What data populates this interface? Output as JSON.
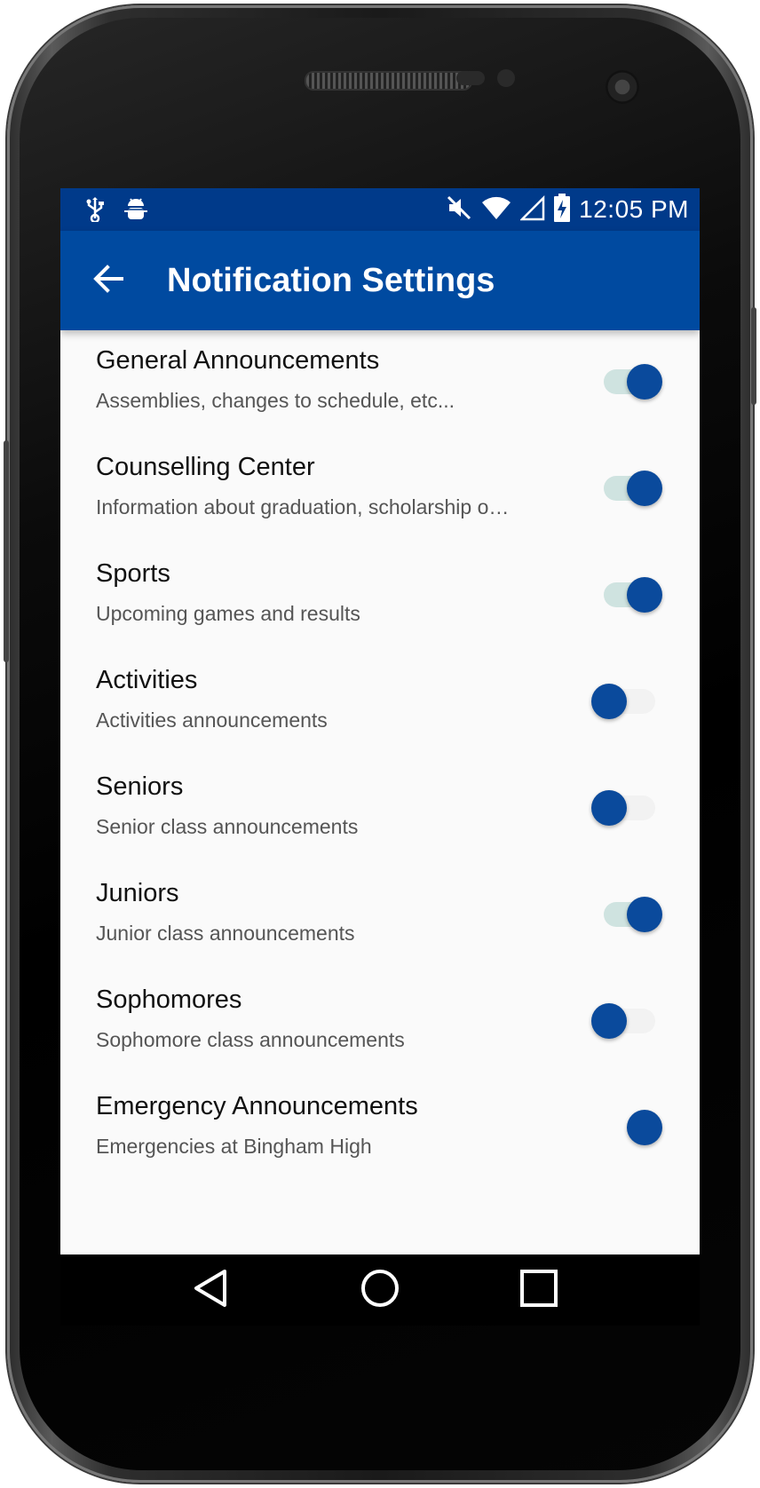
{
  "status_bar": {
    "time": "12:05 PM",
    "icons": [
      "usb-icon",
      "android-debug-icon",
      "mute-icon",
      "wifi-icon",
      "signal-icon",
      "battery-charging-icon"
    ]
  },
  "app_bar": {
    "title": "Notification Settings",
    "back_icon": "arrow-back-icon"
  },
  "settings": [
    {
      "title": "General Announcements",
      "subtitle": "Assemblies, changes to schedule, etc...",
      "enabled": true
    },
    {
      "title": "Counselling Center",
      "subtitle": "Information about graduation, scholarship o…",
      "enabled": true
    },
    {
      "title": "Sports",
      "subtitle": "Upcoming games and results",
      "enabled": true
    },
    {
      "title": "Activities",
      "subtitle": "Activities announcements",
      "enabled": false
    },
    {
      "title": "Seniors",
      "subtitle": "Senior class announcements",
      "enabled": false
    },
    {
      "title": "Juniors",
      "subtitle": "Junior class announcements",
      "enabled": true
    },
    {
      "title": "Sophomores",
      "subtitle": "Sophomore class announcements",
      "enabled": false
    },
    {
      "title": "Emergency Announcements",
      "subtitle": "Emergencies at Bingham High",
      "enabled": true
    }
  ],
  "nav_bar": {
    "buttons": [
      "back-triangle-icon",
      "home-circle-icon",
      "recents-square-icon"
    ]
  },
  "colors": {
    "status_bar": "#003a8a",
    "app_bar": "#004aa0",
    "switch_thumb": "#0a4a9c",
    "switch_track_on": "#cfe3e0",
    "background": "#fafafa"
  }
}
